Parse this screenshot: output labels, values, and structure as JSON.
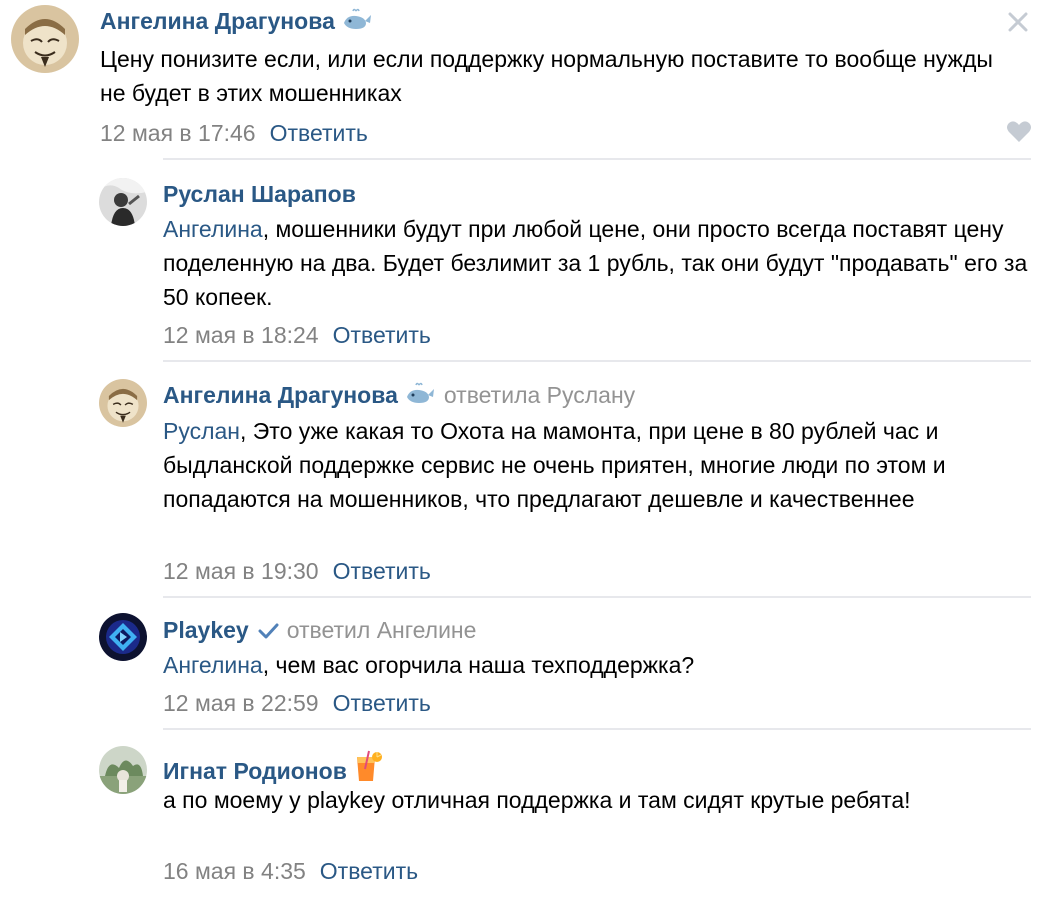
{
  "reply_label": "Ответить",
  "colors": {
    "link": "#2a5885",
    "muted": "#828282",
    "divider": "#e7e8ec"
  },
  "comments": [
    {
      "author": "Ангелина Драгунова",
      "author_icon": "whale-emoji-icon",
      "text": "Цену понизите если, или если поддержку нормальную поставите то вообще нужды не будет в этих мошенниках",
      "date": "12 мая в 17:46"
    },
    {
      "author": "Руслан Шарапов",
      "mention": "Ангелина",
      "text": ", мошенники будут при любой цене, они просто всегда поставят цену поделенную на два. Будет безлимит за 1 рубль, так они будут \"продавать\" его за 50 копеек.",
      "date": "12 мая в 18:24"
    },
    {
      "author": "Ангелина Драгунова",
      "author_icon": "whale-emoji-icon",
      "replied_to": "ответила Руслану",
      "mention": "Руслан",
      "text": ", Это уже какая то Охота на мамонта, при цене в 80 рублей час и быдланской поддержке сервис не очень приятен, многие люди по этом и попадаются на мошенников, что предлагают дешевле и качественнее",
      "date": "12 мая в 19:30"
    },
    {
      "author": "Playkey",
      "author_icon": "verified-check-icon",
      "replied_to": "ответил Ангелине",
      "mention": "Ангелина",
      "text": ", чем вас огорчила наша техподдержка?",
      "date": "12 мая в 22:59"
    },
    {
      "author": "Игнат Родионов",
      "author_icon": "cocktail-emoji-icon",
      "text": "а по моему у playkey отличная поддержка и там сидят крутые ребята!",
      "date": "16 мая в 4:35"
    }
  ]
}
